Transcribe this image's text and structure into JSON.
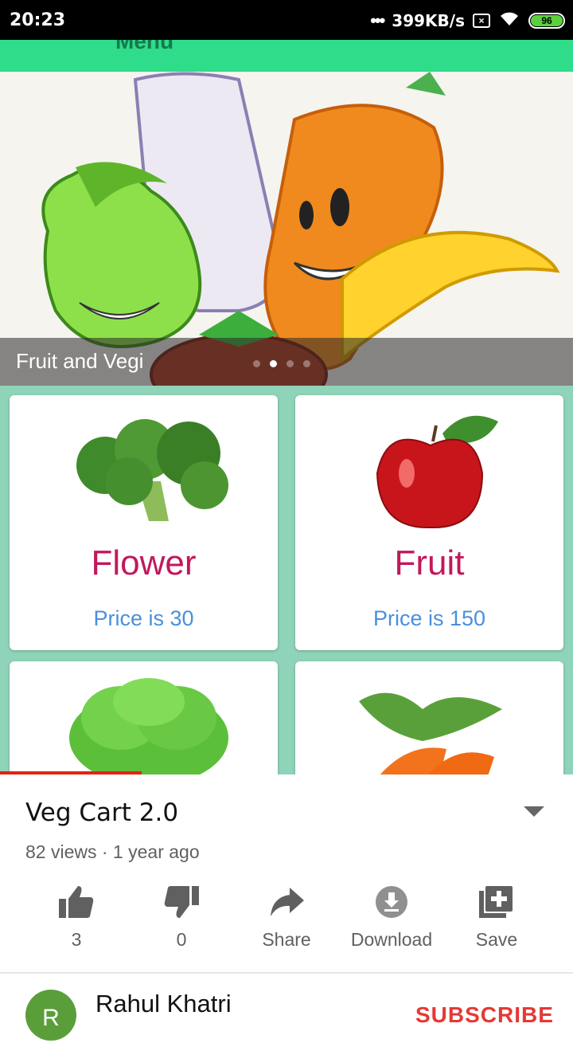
{
  "status_bar": {
    "time": "20:23",
    "dots": "•••",
    "speed": "399KB/s",
    "sim": "×",
    "battery": "96"
  },
  "app": {
    "appbar_title": "Menu",
    "banner_caption": "Fruit and Vegi",
    "products": [
      {
        "name": "Flower",
        "price": "Price is 30"
      },
      {
        "name": "Fruit",
        "price": "Price is 150"
      }
    ]
  },
  "video": {
    "title": "Veg Cart 2.0",
    "meta": "82 views · 1 year ago",
    "progress_fraction": 0.25
  },
  "actions": {
    "like_count": "3",
    "dislike_count": "0",
    "share": "Share",
    "download": "Download",
    "save": "Save"
  },
  "channel": {
    "avatar_letter": "R",
    "name": "Rahul Khatri",
    "subscribe": "SUBSCRIBE"
  },
  "colors": {
    "appbar": "#2edc8a",
    "product_name": "#c2185b",
    "price": "#4a8fde",
    "subscribe": "#e53935",
    "progress": "#e62117"
  }
}
